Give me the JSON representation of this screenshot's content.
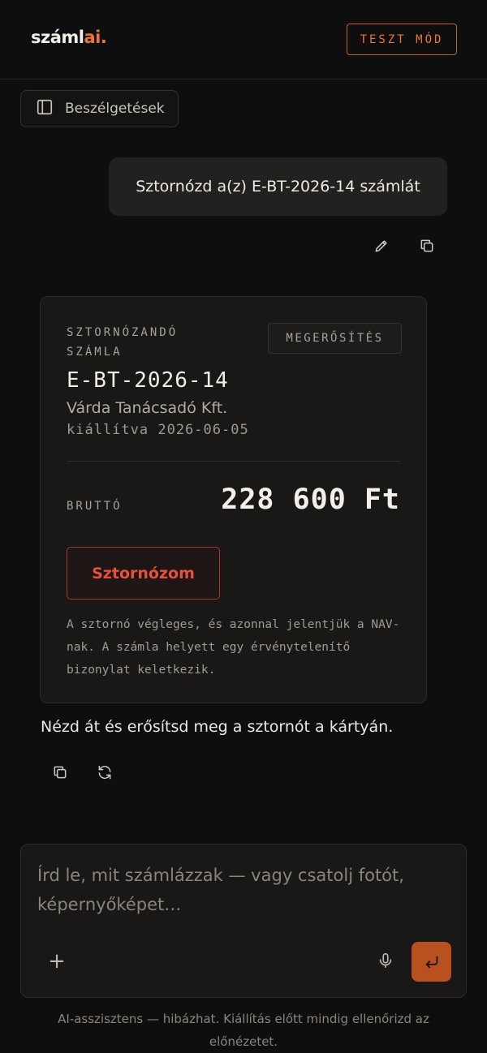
{
  "header": {
    "logo_main": "száml",
    "logo_accent": "ai.",
    "mode_badge": "TESZT MÓD"
  },
  "sidebar_toggle": {
    "label": "Beszélgetések",
    "icon": "sidebar-panel-icon"
  },
  "user_message": {
    "text": "Sztornózd a(z) E-BT-2026-14 számlát",
    "actions": [
      "edit-icon",
      "copy-icon"
    ]
  },
  "invoice_card": {
    "kicker": "SZTORNÓZANDÓ SZÁMLA",
    "tag": "MEGERŐSÍTÉS",
    "invoice_number": "E-BT-2026-14",
    "company": "Várda Tanácsadó Kft.",
    "issued": "kiállítva 2026-06-05",
    "gross_label": "BRUTTÓ",
    "gross_amount": "228 600 Ft",
    "storno_button": "Sztornózom",
    "note": "A sztornó végleges, és azonnal jelentjük a NAV-nak. A számla helyett egy érvénytelenítő bizonylat keletkezik."
  },
  "assistant_message": {
    "text": "Nézd át és erősítsd meg a sztornót a kártyán.",
    "actions": [
      "copy-icon",
      "regenerate-icon"
    ]
  },
  "composer": {
    "placeholder": "Írd le, mit számlázzak — vagy csatolj fotót, képernyőképet…",
    "attach_icon": "plus-icon",
    "mic_icon": "microphone-icon",
    "send_icon": "enter-icon"
  },
  "disclaimer": "AI-asszisztens — hibázhat. Kiállítás előtt mindig ellenőrizd az előnézetet.",
  "colors": {
    "background": "#0f0e0e",
    "accent": "#e8763a",
    "danger": "#e6503f",
    "send_button": "#b8511f"
  }
}
